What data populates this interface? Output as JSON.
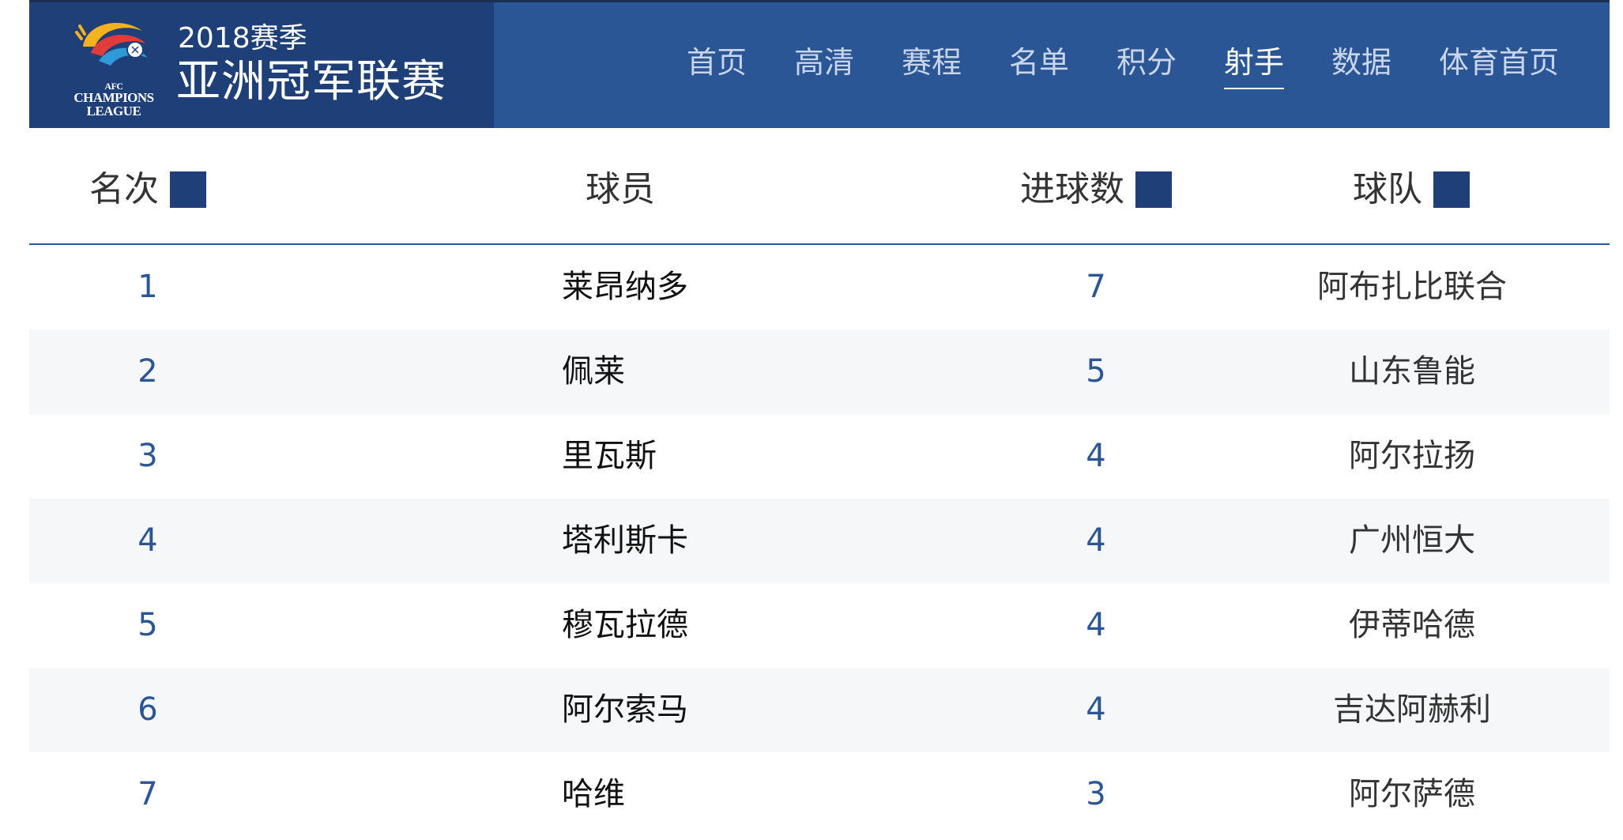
{
  "header": {
    "logo": {
      "icon": "afc-champions-league-logo",
      "text_line1": "AFC",
      "text_line2": "CHAMPIONS",
      "text_line3": "LEAGUE"
    },
    "season": "2018赛季",
    "league": "亚洲冠军联赛",
    "nav": [
      {
        "label": "首页"
      },
      {
        "label": "高清"
      },
      {
        "label": "赛程"
      },
      {
        "label": "名单"
      },
      {
        "label": "积分"
      },
      {
        "label": "射手",
        "active": true
      },
      {
        "label": "数据"
      },
      {
        "label": "体育首页"
      }
    ]
  },
  "colors": {
    "header_bg": "#2b5695",
    "brand_bg": "#1e3f78",
    "accent": "#2b5695",
    "row_alt_bg": "#f6f7f9"
  },
  "table": {
    "columns": {
      "rank": "名次",
      "player": "球员",
      "goals": "进球数",
      "team": "球队"
    },
    "rows": [
      {
        "rank": "1",
        "player": "莱昂纳多",
        "goals": "7",
        "team": "阿布扎比联合"
      },
      {
        "rank": "2",
        "player": "佩莱",
        "goals": "5",
        "team": "山东鲁能"
      },
      {
        "rank": "3",
        "player": "里瓦斯",
        "goals": "4",
        "team": "阿尔拉扬"
      },
      {
        "rank": "4",
        "player": "塔利斯卡",
        "goals": "4",
        "team": "广州恒大"
      },
      {
        "rank": "5",
        "player": "穆瓦拉德",
        "goals": "4",
        "team": "伊蒂哈德"
      },
      {
        "rank": "6",
        "player": "阿尔索马",
        "goals": "4",
        "team": "吉达阿赫利"
      },
      {
        "rank": "7",
        "player": "哈维",
        "goals": "3",
        "team": "阿尔萨德"
      }
    ]
  }
}
